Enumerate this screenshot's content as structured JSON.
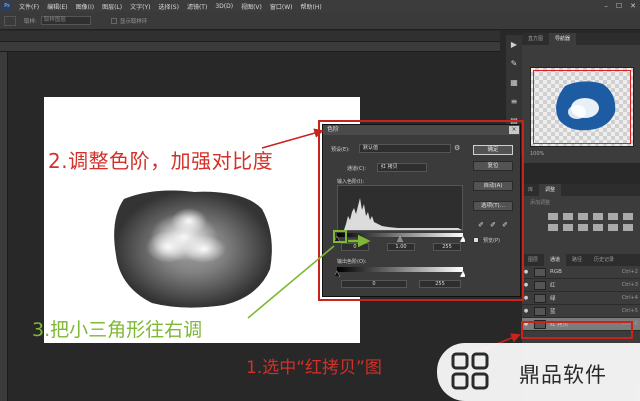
{
  "menubar": {
    "logo": "Ps",
    "items": [
      "文件(F)",
      "编辑(E)",
      "图像(I)",
      "图层(L)",
      "文字(Y)",
      "选择(S)",
      "滤镜(T)",
      "3D(D)",
      "视图(V)",
      "窗口(W)",
      "帮助(H)"
    ],
    "win_min": "–",
    "win_max": "☐",
    "win_close": "✕"
  },
  "optionsbar": {
    "sample_label": "取样:",
    "sample_value": "取样图层",
    "show_ring_label": "显示取样环"
  },
  "panels": {
    "nav_tabs": [
      "直方图",
      "导航器"
    ],
    "nav_zoom": "100%",
    "adj_tabs": [
      "库",
      "调整"
    ],
    "adj_title": "添加调整",
    "ch_tabs": [
      "图层",
      "通道",
      "路径",
      "历史记录"
    ],
    "channels": [
      {
        "name": "RGB",
        "shortcut": "Ctrl+2",
        "selected": false
      },
      {
        "name": "红",
        "shortcut": "Ctrl+3",
        "selected": false
      },
      {
        "name": "绿",
        "shortcut": "Ctrl+4",
        "selected": false
      },
      {
        "name": "蓝",
        "shortcut": "Ctrl+5",
        "selected": false
      },
      {
        "name": "红 拷贝",
        "shortcut": "Ctrl+6",
        "selected": true
      }
    ]
  },
  "levels_dialog": {
    "title": "色阶",
    "close": "×",
    "preset_label": "预设(E):",
    "preset_value": "默认值",
    "channel_label": "通道(C):",
    "channel_value": "红 拷贝",
    "input_label": "输入色阶(I):",
    "output_label": "输出色阶(O):",
    "input_black": "0",
    "input_gamma": "1.00",
    "input_white": "255",
    "output_black": "0",
    "output_white": "255",
    "btn_ok": "确定",
    "btn_reset": "复位",
    "btn_auto": "自动(A)",
    "btn_options": "选项(T)...",
    "preview_label": "预览(P)"
  },
  "annotations": {
    "step2": "2.调整色阶，加强对比度",
    "step3": "3.把小三角形往右调",
    "step1": "1.选中“红拷贝”图"
  },
  "watermark": {
    "text": "鼎品软件"
  },
  "colors": {
    "annotation_red": "#d23028",
    "annotation_green": "#7eb834",
    "frame_red": "#c8241c"
  }
}
